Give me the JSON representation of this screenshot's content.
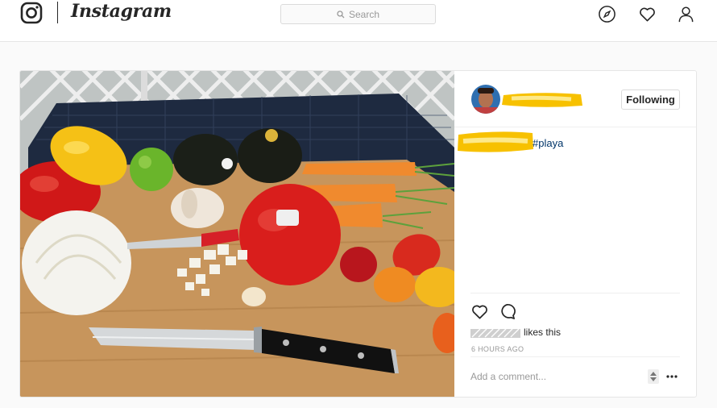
{
  "nav": {
    "wordmark": "Instagram",
    "search_placeholder": "Search",
    "icons": [
      "instagram-logo-icon",
      "search-icon",
      "compass-icon",
      "heart-icon",
      "profile-icon"
    ]
  },
  "post": {
    "follow_label": "Following",
    "caption_hashtag": "#playa",
    "likes_suffix": "likes this",
    "time_ago": "6 HOURS AGO",
    "comment_placeholder": "Add a comment...",
    "icons": [
      "heart-icon",
      "comment-icon",
      "more-options-icon"
    ]
  },
  "colors": {
    "hashtag": "#003569",
    "redaction": "#f7c100",
    "border": "#e6e6e6"
  }
}
